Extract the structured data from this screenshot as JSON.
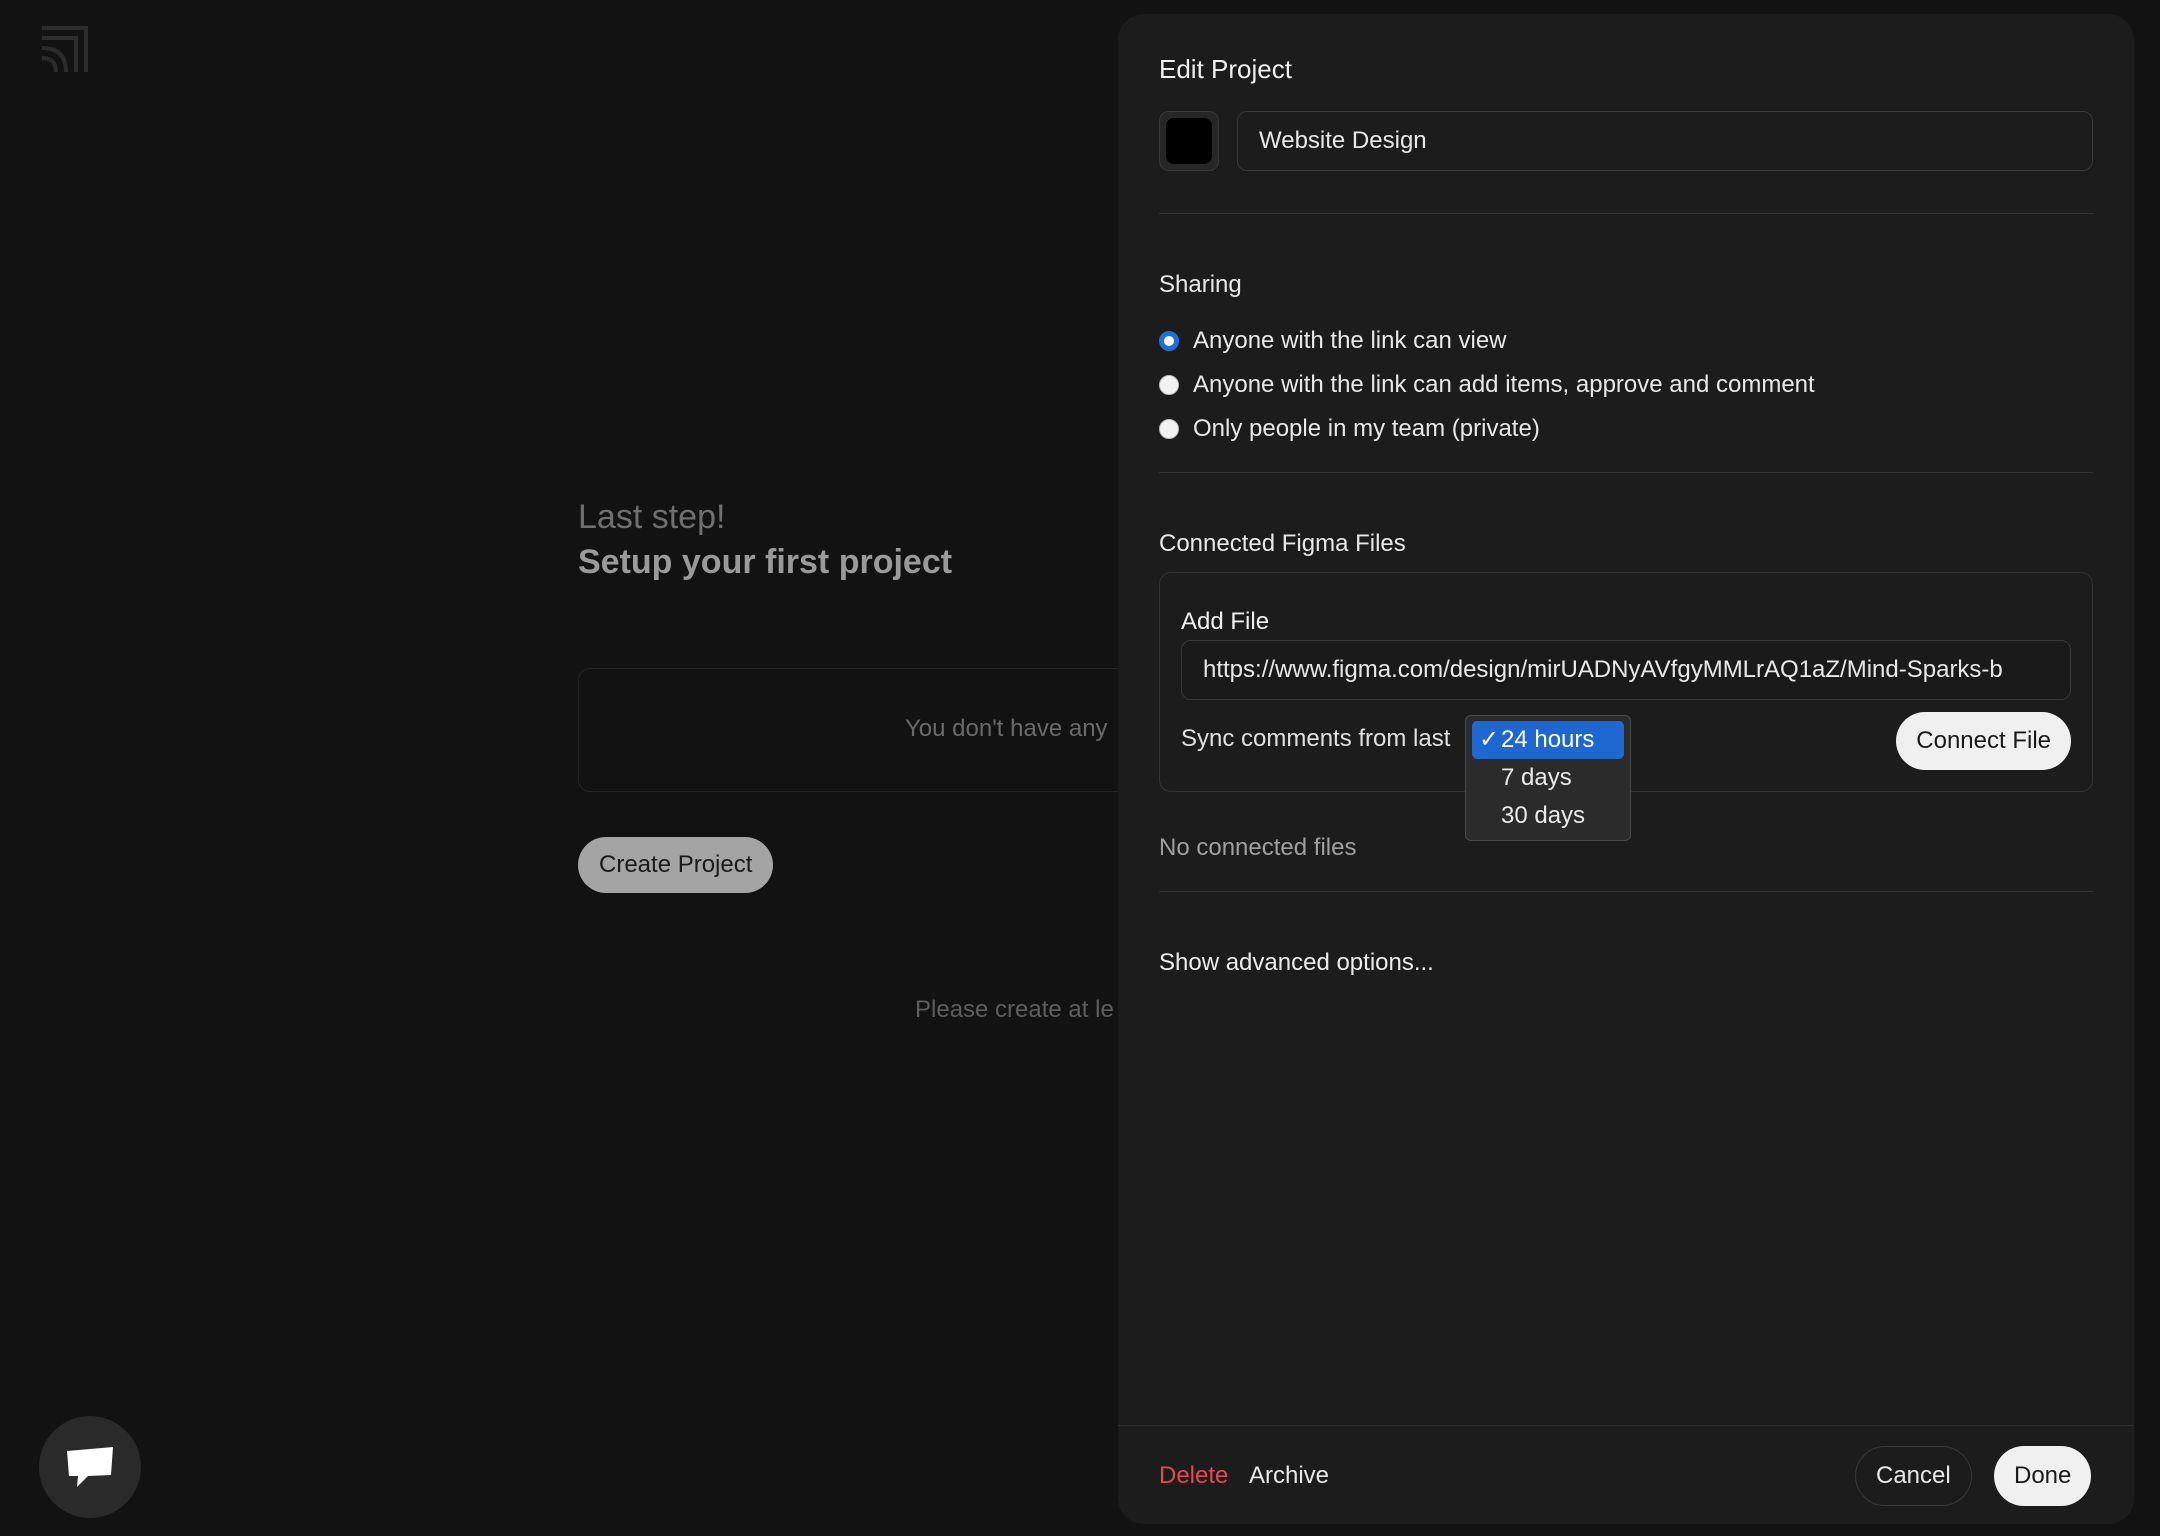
{
  "background": {
    "subheading": "Last step!",
    "heading": "Setup your first project",
    "empty_text": "You don't have any",
    "create_button": "Create Project",
    "helper_text": "Please create at le"
  },
  "panel": {
    "title": "Edit Project",
    "project_color": "#000000",
    "project_name": "Website Design",
    "sharing": {
      "title": "Sharing",
      "options": [
        {
          "label": "Anyone with the link can view",
          "checked": true
        },
        {
          "label": "Anyone with the link can add items, approve and comment",
          "checked": false
        },
        {
          "label": "Only people in my team (private)",
          "checked": false
        }
      ]
    },
    "figma": {
      "title": "Connected Figma Files",
      "add_file_label": "Add File",
      "url_value": "https://www.figma.com/design/mirUADNyAVfgyMMLrAQ1aZ/Mind-Sparks-b",
      "sync_label": "Sync comments from last",
      "sync_options": [
        "24 hours",
        "7 days",
        "30 days"
      ],
      "sync_selected": "24 hours",
      "check_glyph": "✓",
      "connect_button": "Connect File",
      "no_files": "No connected files"
    },
    "advanced_link": "Show advanced options...",
    "footer": {
      "delete": "Delete",
      "archive": "Archive",
      "cancel": "Cancel",
      "done": "Done"
    }
  },
  "colors": {
    "accent": "#1e6fd9",
    "danger": "#e5484d",
    "panel_bg": "#1c1c1c",
    "page_bg": "#121212"
  },
  "icons": {
    "logo": "app-logo-icon",
    "chat": "chat-bubble-icon"
  }
}
